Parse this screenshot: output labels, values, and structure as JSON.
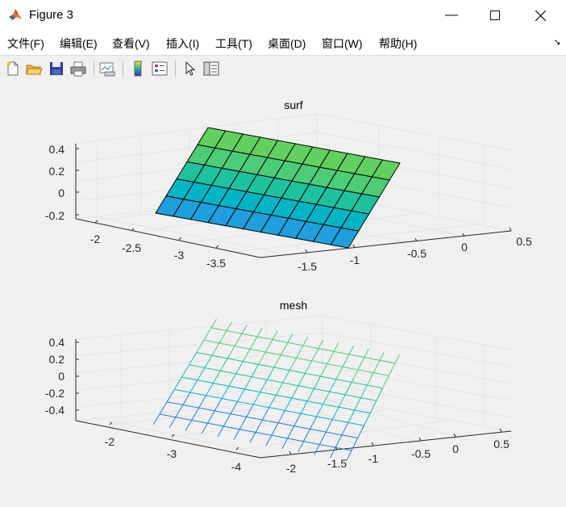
{
  "window": {
    "title": "Figure 3"
  },
  "menu": {
    "items": [
      "文件(F)",
      "编辑(E)",
      "查看(V)",
      "插入(I)",
      "工具(T)",
      "桌面(D)",
      "窗口(W)",
      "帮助(H)"
    ]
  },
  "toolbar": {
    "icons": [
      "new-figure-icon",
      "open-file-icon",
      "save-icon",
      "print-icon",
      "link-plot-icon",
      "colorbar-icon",
      "legend-icon",
      "pointer-icon",
      "property-inspector-icon"
    ]
  },
  "chart_data": [
    {
      "type": "surface",
      "title": "surf",
      "xlabel": "",
      "ylabel": "",
      "zlabel": "",
      "x_ticks": [
        "-2",
        "-2.5",
        "-3",
        "-3.5"
      ],
      "y_ticks": [
        "-1.5",
        "-1",
        "-0.5",
        "0",
        "0.5"
      ],
      "z_ticks": [
        "0.4",
        "0.2",
        "0",
        "-0.2"
      ],
      "grid": true,
      "colormap": [
        "#1f9fdd",
        "#02b5c5",
        "#1ec29e",
        "#4dcc77",
        "#62d05e"
      ]
    },
    {
      "type": "mesh",
      "title": "mesh",
      "xlabel": "",
      "ylabel": "",
      "zlabel": "",
      "x_ticks": [
        "-2",
        "-3",
        "-4"
      ],
      "y_ticks": [
        "-2",
        "-1.5",
        "-1",
        "-0.5",
        "0",
        "0.5"
      ],
      "z_ticks": [
        "0.4",
        "0.2",
        "0",
        "-0.2",
        "-0.4"
      ],
      "grid": true,
      "colormap": [
        "#1f7fdd",
        "#02b5c5",
        "#1ec29e",
        "#4dcc77"
      ]
    }
  ]
}
